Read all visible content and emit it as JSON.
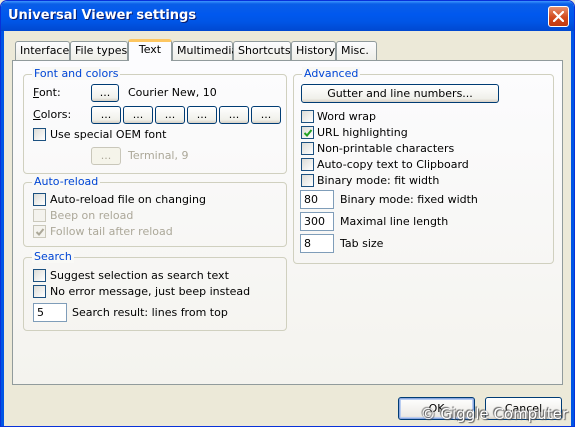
{
  "window": {
    "title": "Universal Viewer settings"
  },
  "tabs": [
    {
      "label": "Interface"
    },
    {
      "label": "File types"
    },
    {
      "label": "Text",
      "active": true
    },
    {
      "label": "Multimedia"
    },
    {
      "label": "Shortcuts"
    },
    {
      "label": "History"
    },
    {
      "label": "Misc."
    }
  ],
  "font_colors": {
    "title": "Font and colors",
    "font_label": "Font:",
    "font_button": "...",
    "font_value": "Courier New, 10",
    "colors_label": "Colors:",
    "color_buttons": [
      "...",
      "...",
      "...",
      "...",
      "...",
      "..."
    ],
    "oem_label": "Use special OEM font",
    "oem_checked": false,
    "oem_button": "...",
    "oem_value": "Terminal, 9"
  },
  "autoreload": {
    "title": "Auto-reload",
    "items": [
      {
        "label": "Auto-reload file on changing",
        "checked": false,
        "enabled": true
      },
      {
        "label": "Beep on reload",
        "checked": false,
        "enabled": false
      },
      {
        "label": "Follow tail after reload",
        "checked": true,
        "enabled": false
      }
    ]
  },
  "search": {
    "title": "Search",
    "items": [
      {
        "label": "Suggest selection as search text",
        "checked": false
      },
      {
        "label": "No error message, just beep instead",
        "checked": false
      }
    ],
    "lines_value": "5",
    "lines_label": "Search result: lines from top"
  },
  "advanced": {
    "title": "Advanced",
    "gutter_button": "Gutter and line numbers...",
    "items": [
      {
        "label": "Word wrap",
        "checked": false
      },
      {
        "label": "URL highlighting",
        "checked": true
      },
      {
        "label": "Non-printable characters",
        "checked": false
      },
      {
        "label": "Auto-copy text to Clipboard",
        "checked": false
      },
      {
        "label": "Binary mode: fit width",
        "checked": false
      }
    ],
    "fields": [
      {
        "value": "80",
        "label": "Binary mode: fixed width"
      },
      {
        "value": "300",
        "label": "Maximal line length"
      },
      {
        "value": "8",
        "label": "Tab size"
      }
    ]
  },
  "footer": {
    "ok_label": "OK",
    "cancel_label": "Cancel",
    "watermark": "© Giggle Computer"
  },
  "colors": {
    "title_bar": "#0055e5",
    "group_title": "#0046d5",
    "tab_highlight": "#fdc660"
  }
}
